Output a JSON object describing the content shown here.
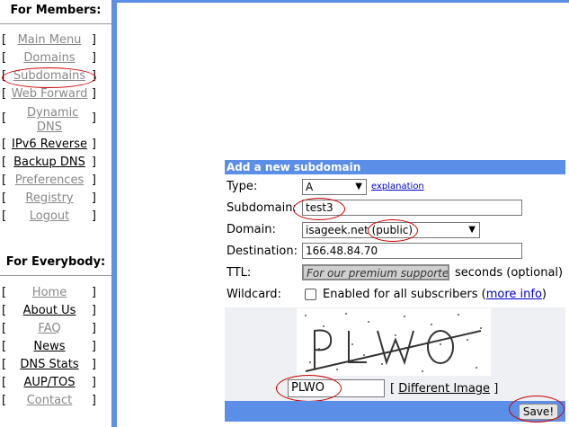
{
  "sidebar": {
    "members_title": "For Members:",
    "members_items": [
      {
        "label": "Main Menu"
      },
      {
        "label": "Domains"
      },
      {
        "label": "Subdomains"
      },
      {
        "label": "Web Forward"
      },
      {
        "label": "Dynamic DNS"
      },
      {
        "label": "IPv6 Reverse"
      },
      {
        "label": "Backup DNS"
      },
      {
        "label": "Preferences"
      },
      {
        "label": "Registry"
      },
      {
        "label": "Logout"
      }
    ],
    "everybody_title": "For Everybody:",
    "everybody_items": [
      {
        "label": "Home"
      },
      {
        "label": "About Us"
      },
      {
        "label": "FAQ"
      },
      {
        "label": "News"
      },
      {
        "label": "DNS Stats"
      },
      {
        "label": "AUP/TOS"
      },
      {
        "label": "Contact"
      }
    ],
    "bracket_left": "[",
    "bracket_right": "]"
  },
  "form": {
    "header": "Add a new subdomain",
    "type_label": "Type:",
    "type_value": "A",
    "explanation_link": "explanation",
    "subdomain_label": "Subdomain:",
    "subdomain_value": "test3",
    "domain_label": "Domain:",
    "domain_value": "isageek.net (public)",
    "destination_label": "Destination:",
    "destination_value": "166.48.84.70",
    "ttl_label": "TTL:",
    "ttl_placeholder": "For our premium supporter",
    "ttl_suffix": "seconds (optional)",
    "wildcard_label": "Wildcard:",
    "wildcard_text": "Enabled for all subscribers (",
    "wildcard_more": "more info",
    "wildcard_close": ")",
    "captcha_text": "PLWO",
    "captcha_value": "PLWO",
    "different_image": "Different Image",
    "bracket_left": "[",
    "bracket_right": "]",
    "save_label": "Save!"
  },
  "colors": {
    "accent": "#5b8ee6",
    "annotation": "#cc0000"
  },
  "icons": {
    "dropdown": "chevron-down-icon",
    "checkbox": "checkbox-icon"
  }
}
